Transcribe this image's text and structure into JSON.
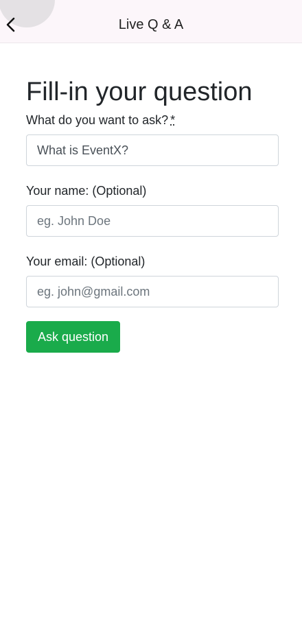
{
  "header": {
    "back_icon": "chevron-left-icon",
    "title": "Live Q & A",
    "background": "#fcf6fa"
  },
  "form": {
    "heading": "Fill-in your question",
    "question": {
      "label": "What do you want to ask?",
      "required_mark": "*",
      "value": "What is EventX?"
    },
    "name": {
      "label": "Your name: (Optional)",
      "placeholder": "eg. John Doe"
    },
    "email": {
      "label": "Your email: (Optional)",
      "placeholder": "eg. john@gmail.com"
    },
    "submit_label": "Ask question",
    "accent": "#1aab4b"
  }
}
